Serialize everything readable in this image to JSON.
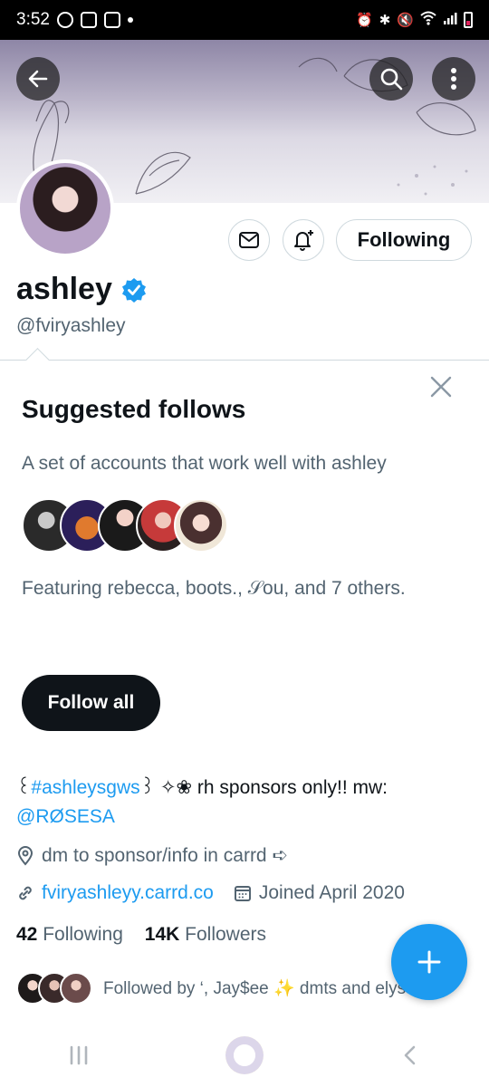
{
  "status_bar": {
    "time": "3:52"
  },
  "profile": {
    "display_name": "ashley",
    "handle": "@fviryashley",
    "following_button": "Following"
  },
  "suggested": {
    "title": "Suggested follows",
    "subtitle": "A set of accounts that work well with ashley",
    "featuring": "Featuring rebecca, boots., 𝒮ou, and 7 others.",
    "follow_all": "Follow all"
  },
  "bio": {
    "pre": "꒰",
    "hashtag": "#ashleysgws",
    "post": "꒱ ✧❀ rh sponsors only!! mw:",
    "mention": "@RØSESA"
  },
  "meta": {
    "location": "dm to sponsor/info in carrd ➪",
    "website": "fviryashleyy.carrd.co",
    "joined": "Joined April 2020"
  },
  "counts": {
    "following_num": "42",
    "following_label": "Following",
    "followers_num": "14K",
    "followers_label": "Followers"
  },
  "followed_by": "Followed by ‘, Jay$ee ✨ dmts and elyssa",
  "colors": {
    "accent": "#1d9bf0",
    "text": "#0f1419",
    "secondary": "#536471",
    "border": "#cfd9de"
  }
}
